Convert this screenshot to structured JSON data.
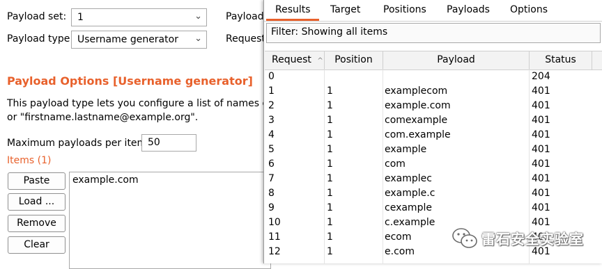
{
  "left": {
    "payload_set_label": "Payload set:",
    "payload_set_value": "1",
    "payload_type_label": "Payload type:",
    "payload_type_value": "Username generator",
    "payload_count_label": "Payload",
    "request_count_label": "Request",
    "section_title": "Payload Options [Username generator]",
    "description_line1": "This payload type lets you configure a list of names or em",
    "description_line2": "or \"firstname.lastname@example.org\".",
    "max_payloads_label": "Maximum payloads per item:",
    "max_payloads_value": "50",
    "items_label": "Items (1)",
    "buttons": [
      "Paste",
      "Load ...",
      "Remove",
      "Clear"
    ],
    "items": [
      "example.com"
    ]
  },
  "results": {
    "tabs": [
      "Results",
      "Target",
      "Positions",
      "Payloads",
      "Options"
    ],
    "active_tab": "Results",
    "filter_text": "Filter: Showing all items",
    "columns": [
      "Request",
      "Position",
      "Payload",
      "Status"
    ],
    "sort_indicator": "^",
    "rows": [
      {
        "request": "0",
        "position": "",
        "payload": "",
        "status": "204"
      },
      {
        "request": "1",
        "position": "1",
        "payload": "examplecom",
        "status": "401"
      },
      {
        "request": "2",
        "position": "1",
        "payload": "example.com",
        "status": "401"
      },
      {
        "request": "3",
        "position": "1",
        "payload": "comexample",
        "status": "401"
      },
      {
        "request": "4",
        "position": "1",
        "payload": "com.example",
        "status": "401"
      },
      {
        "request": "5",
        "position": "1",
        "payload": "example",
        "status": "401"
      },
      {
        "request": "6",
        "position": "1",
        "payload": "com",
        "status": "401"
      },
      {
        "request": "7",
        "position": "1",
        "payload": "examplec",
        "status": "401"
      },
      {
        "request": "8",
        "position": "1",
        "payload": "example.c",
        "status": "401"
      },
      {
        "request": "9",
        "position": "1",
        "payload": "cexample",
        "status": "401"
      },
      {
        "request": "10",
        "position": "1",
        "payload": "c.example",
        "status": "401"
      },
      {
        "request": "11",
        "position": "1",
        "payload": "ecom",
        "status": "401"
      },
      {
        "request": "12",
        "position": "1",
        "payload": "e.com",
        "status": "401"
      }
    ]
  },
  "watermark": {
    "icon": "wechat-icon",
    "text": "雷石安全实验室"
  },
  "colors": {
    "accent": "#e8612c"
  }
}
